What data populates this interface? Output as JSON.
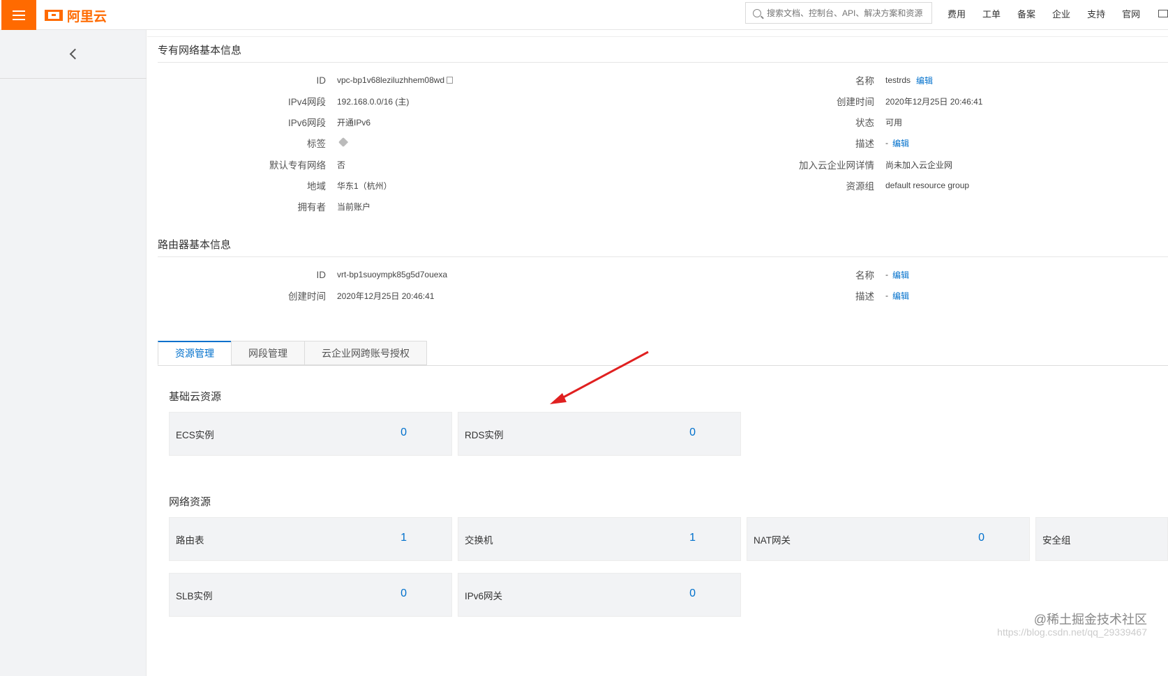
{
  "topbar": {
    "logo_text": "阿里云",
    "search_placeholder": "搜索文档、控制台、API、解决方案和资源",
    "nav": [
      "费用",
      "工单",
      "备案",
      "企业",
      "支持",
      "官网"
    ]
  },
  "vpc": {
    "section_title": "专有网络基本信息",
    "left": [
      {
        "label": "ID",
        "value": "vpc-bp1v68leziluzhhem08wd"
      },
      {
        "label": "IPv4网段",
        "value": "192.168.0.0/16 (主)"
      },
      {
        "label": "IPv6网段",
        "value": "开通IPv6"
      },
      {
        "label": "标签",
        "value": ""
      },
      {
        "label": "默认专有网络",
        "value": "否"
      },
      {
        "label": "地域",
        "value": "华东1（杭州）"
      },
      {
        "label": "拥有者",
        "value": "当前账户"
      }
    ],
    "right": [
      {
        "label": "名称",
        "value": "testrds",
        "action": "编辑"
      },
      {
        "label": "创建时间",
        "value": "2020年12月25日 20:46:41"
      },
      {
        "label": "状态",
        "value": "可用"
      },
      {
        "label": "描述",
        "value": "-",
        "action": "编辑"
      },
      {
        "label": "加入云企业网详情",
        "value": "尚未加入云企业网"
      },
      {
        "label": "资源组",
        "value": "default resource group"
      }
    ]
  },
  "router": {
    "section_title": "路由器基本信息",
    "left": [
      {
        "label": "ID",
        "value": "vrt-bp1suoympk85g5d7ouexa"
      },
      {
        "label": "创建时间",
        "value": "2020年12月25日 20:46:41"
      }
    ],
    "right": [
      {
        "label": "名称",
        "value": "-",
        "action": "编辑"
      },
      {
        "label": "描述",
        "value": "-",
        "action": "编辑"
      }
    ]
  },
  "tabs": [
    {
      "label": "资源管理",
      "active": true
    },
    {
      "label": "网段管理",
      "active": false
    },
    {
      "label": "云企业网跨账号授权",
      "active": false
    }
  ],
  "basic_resources": {
    "title": "基础云资源",
    "cards": [
      {
        "label": "ECS实例",
        "count": "0"
      },
      {
        "label": "RDS实例",
        "count": "0"
      }
    ]
  },
  "network_resources": {
    "title": "网络资源",
    "cards": [
      {
        "label": "路由表",
        "count": "1"
      },
      {
        "label": "交换机",
        "count": "1"
      },
      {
        "label": "NAT网关",
        "count": "0"
      },
      {
        "label": "安全组",
        "count": ""
      },
      {
        "label": "SLB实例",
        "count": "0"
      },
      {
        "label": "IPv6网关",
        "count": "0"
      }
    ]
  },
  "watermark": {
    "line1": "@稀土掘金技术社区",
    "line2": "https://blog.csdn.net/qq_29339467"
  },
  "colors": {
    "brand": "#ff6a00",
    "link": "#0070cc",
    "status_ok": "#1e9e39"
  }
}
